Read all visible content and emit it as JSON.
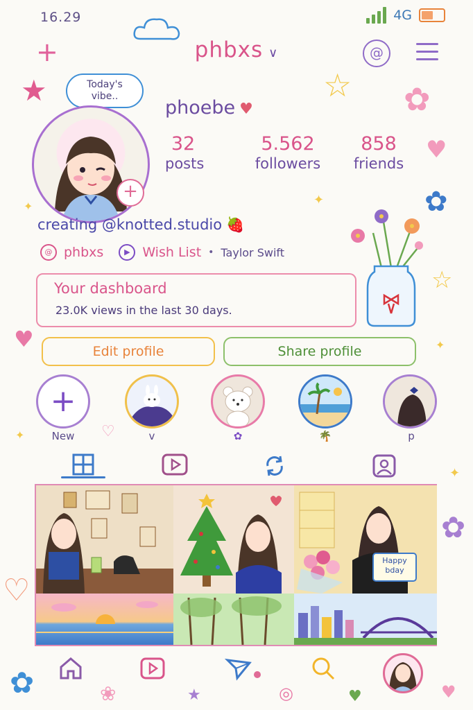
{
  "status_bar": {
    "time": "16.29",
    "network": "4G",
    "battery_level": 0.6
  },
  "header": {
    "username": "phbxs"
  },
  "profile": {
    "bubble_line1": "Today's",
    "bubble_line2": "vibe..",
    "display_name": "phoebe",
    "stats": [
      {
        "value": "32",
        "label": "posts"
      },
      {
        "value": "5.562",
        "label": "followers"
      },
      {
        "value": "858",
        "label": "friends"
      }
    ],
    "bio": "creating @knotted.studio",
    "links": {
      "threads": "phbxs",
      "wishlist": "Wish List",
      "music": "Taylor Swift"
    }
  },
  "dashboard": {
    "title": "Your dashboard",
    "subtitle": "23.0K views in the last 30 days."
  },
  "buttons": {
    "edit": "Edit profile",
    "share": "Share profile"
  },
  "highlights": [
    {
      "label": "New"
    },
    {
      "label": "v"
    },
    {
      "label": ""
    },
    {
      "label": ""
    },
    {
      "label": "p"
    }
  ],
  "posts": {
    "bday_text_line1": "Happy",
    "bday_text_line2": "bday"
  },
  "colors": {
    "accent_pink": "#d9548a",
    "accent_purple": "#6b4ca0",
    "accent_blue": "#3d7ac9"
  }
}
